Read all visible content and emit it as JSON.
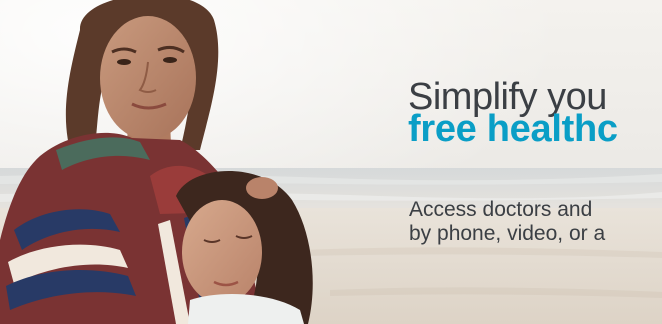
{
  "hero": {
    "headline_line1": "Simplify you",
    "headline_line2": "free healthc",
    "subtext_line1": "Access doctors and",
    "subtext_line2": "by phone, video, or a",
    "photo_subject": "mother-and-daughter-on-beach-photo",
    "colors": {
      "headline": "#3b3f44",
      "accent": "#0a9ec6",
      "background": "#f2efeb"
    }
  }
}
